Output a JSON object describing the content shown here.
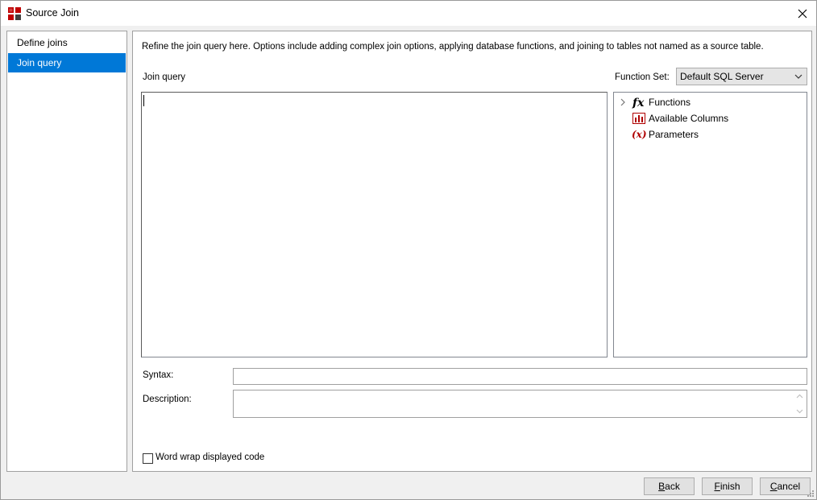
{
  "window": {
    "title": "Source Join",
    "colors": {
      "accent": "#0078d7",
      "panel_bg": "#f0f0f0",
      "border": "#a0a0a0"
    }
  },
  "sidebar": {
    "items": [
      {
        "label": "Define joins",
        "selected": false
      },
      {
        "label": "Join query",
        "selected": true
      }
    ]
  },
  "main": {
    "description": "Refine the join query here.  Options include adding complex join options, applying database functions, and joining to tables not named as a source table.",
    "editor_label": "Join query",
    "editor_value": "",
    "function_set_label": "Function Set:",
    "function_set_value": "Default SQL Server",
    "tree": [
      {
        "label": "Functions",
        "icon": "function-fx-icon",
        "expandable": true
      },
      {
        "label": "Available Columns",
        "icon": "columns-chart-icon",
        "expandable": false
      },
      {
        "label": "Parameters",
        "icon": "parameter-x-icon",
        "expandable": false
      }
    ],
    "syntax_label": "Syntax:",
    "syntax_value": "",
    "description_label": "Description:",
    "description_value": "",
    "word_wrap_label": "Word wrap displayed code",
    "word_wrap_checked": false
  },
  "footer": {
    "back": {
      "before": "",
      "mnemonic": "B",
      "after": "ack"
    },
    "finish": {
      "before": "",
      "mnemonic": "F",
      "after": "inish"
    },
    "cancel": {
      "before": "",
      "mnemonic": "C",
      "after": "ancel"
    }
  }
}
